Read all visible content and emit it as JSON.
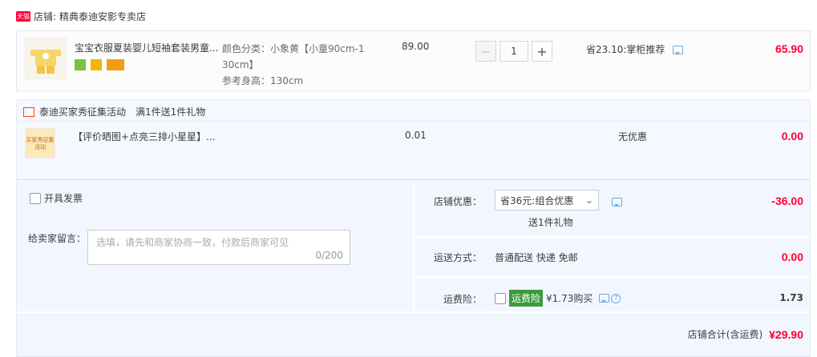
{
  "shop": {
    "badge": "天猫",
    "label": "店铺:",
    "name": "精典泰迪安影专卖店"
  },
  "item1": {
    "title": "宝宝衣服夏装婴儿短袖套装男童...",
    "sku_label": "颜色分类：小象黄【小童90cm-1",
    "sku_line2": "30cm】",
    "height_label": "参考身高：130cm",
    "unit_price": "89.00",
    "quantity": "1",
    "discount": "省23.10:掌柜推荐",
    "total": "65.90"
  },
  "promo": {
    "activity": "泰迪买家秀征集活动",
    "condition": "满1件送1件礼物"
  },
  "item2": {
    "title": "【评价晒图+点亮三排小星星】...",
    "thumb_text": "买家秀征集活动",
    "unit_price": "0.01",
    "discount": "无优惠",
    "total": "0.00"
  },
  "invoice": {
    "label": "开具发票"
  },
  "message": {
    "label": "给卖家留言：",
    "placeholder": "选填，请先和商家协商一致，付款后商家可见",
    "counter": "0/200"
  },
  "coupon": {
    "label": "店铺优惠：",
    "selected": "省36元:组合优惠",
    "gift": "送1件礼物",
    "amount": "-36.00"
  },
  "shipping": {
    "label": "运送方式：",
    "method": "普通配送 快递 免邮",
    "amount": "0.00"
  },
  "insurance": {
    "label": "运费险：",
    "tag": "运费险",
    "price": "¥1.73购买",
    "amount": "1.73"
  },
  "summary": {
    "label": "店铺合计(含运费)",
    "total": "¥29.90"
  }
}
